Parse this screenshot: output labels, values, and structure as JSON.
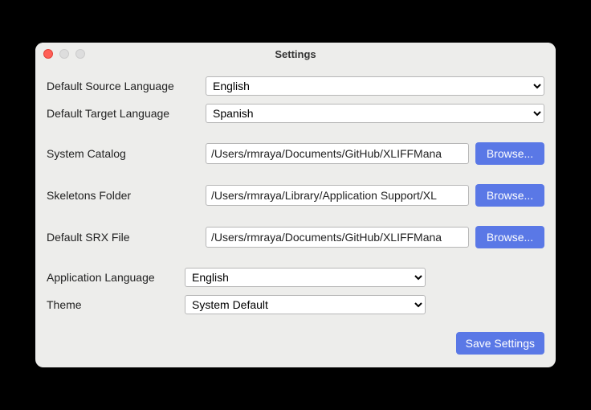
{
  "window_title": "Settings",
  "labels": {
    "source_lang": "Default Source Language",
    "target_lang": "Default Target Language",
    "system_catalog": "System Catalog",
    "skeletons_folder": "Skeletons Folder",
    "default_srx": "Default SRX File",
    "app_lang": "Application Language",
    "theme": "Theme"
  },
  "values": {
    "source_lang": "English",
    "target_lang": "Spanish",
    "system_catalog": "/Users/rmraya/Documents/GitHub/XLIFFMana",
    "skeletons_folder": "/Users/rmraya/Library/Application Support/XL",
    "default_srx": "/Users/rmraya/Documents/GitHub/XLIFFMana",
    "app_lang": "English",
    "theme": "System Default"
  },
  "buttons": {
    "browse": "Browse...",
    "save": "Save Settings"
  }
}
